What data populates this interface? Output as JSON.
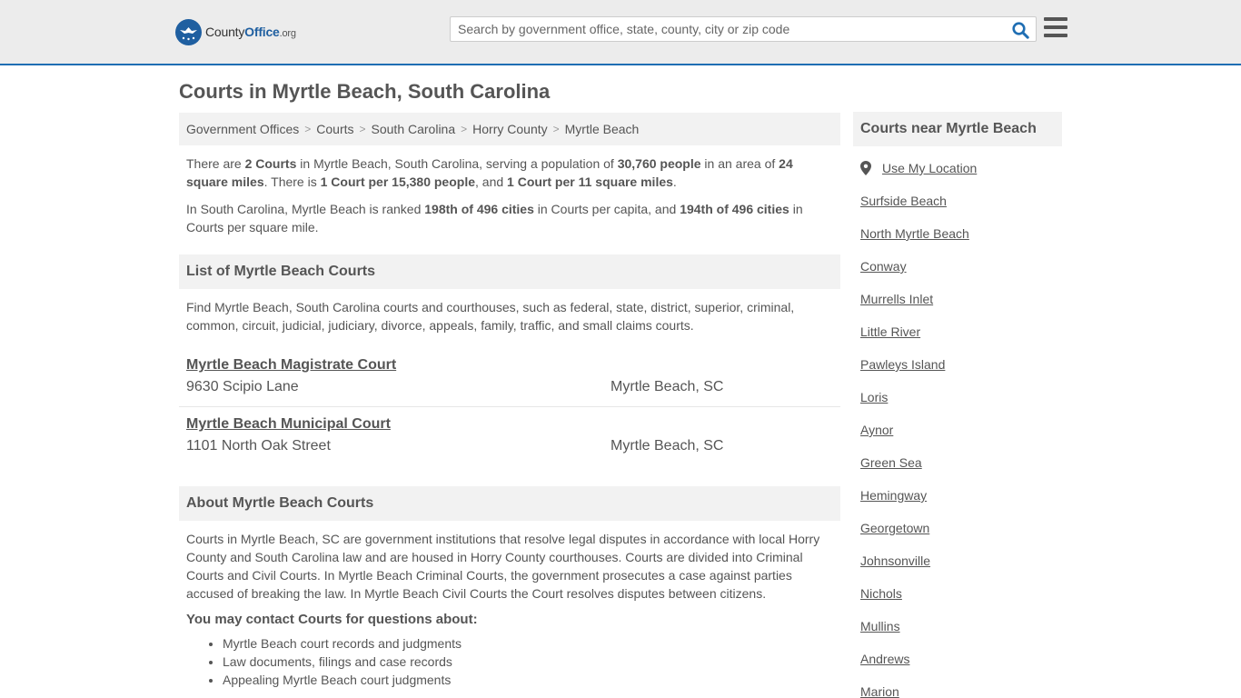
{
  "header": {
    "logo_main": "County",
    "logo_strong": "Office",
    "logo_org": ".org",
    "search_placeholder": "Search by government office, state, county, city or zip code"
  },
  "page_title": "Courts in Myrtle Beach, South Carolina",
  "breadcrumb": [
    "Government Offices",
    "Courts",
    "South Carolina",
    "Horry County",
    "Myrtle Beach"
  ],
  "intro": {
    "p1": {
      "t1": "There are ",
      "b1": "2 Courts",
      "t2": " in Myrtle Beach, South Carolina, serving a population of ",
      "b2": "30,760 people",
      "t3": " in an area of ",
      "b3": "24 square miles",
      "t4": ". There is ",
      "b4": "1 Court per 15,380 people",
      "t5": ", and ",
      "b5": "1 Court per 11 square miles",
      "t6": "."
    },
    "p2": {
      "t1": "In South Carolina, Myrtle Beach is ranked ",
      "b1": "198th of 496 cities",
      "t2": " in Courts per capita, and ",
      "b2": "194th of 496 cities",
      "t3": " in Courts per square mile."
    }
  },
  "list_section": {
    "title": "List of Myrtle Beach Courts",
    "description": "Find Myrtle Beach, South Carolina courts and courthouses, such as federal, state, district, superior, criminal, common, circuit, judicial, judiciary, divorce, appeals, family, traffic, and small claims courts.",
    "courts": [
      {
        "name": "Myrtle Beach Magistrate Court",
        "address": "9630 Scipio Lane",
        "city": "Myrtle Beach, SC"
      },
      {
        "name": "Myrtle Beach Municipal Court",
        "address": "1101 North Oak Street",
        "city": "Myrtle Beach, SC"
      }
    ]
  },
  "about_section": {
    "title": "About Myrtle Beach Courts",
    "description": "Courts in Myrtle Beach, SC are government institutions that resolve legal disputes in accordance with local Horry County and South Carolina law and are housed in Horry County courthouses. Courts are divided into Criminal Courts and Civil Courts. In Myrtle Beach Criminal Courts, the government prosecutes a case against parties accused of breaking the law. In Myrtle Beach Civil Courts the Court resolves disputes between citizens.",
    "contact_head": "You may contact Courts for questions about:",
    "contact_items": [
      "Myrtle Beach court records and judgments",
      "Law documents, filings and case records",
      "Appealing Myrtle Beach court judgments"
    ]
  },
  "sidebar": {
    "title": "Courts near Myrtle Beach",
    "use_location": "Use My Location",
    "cities": [
      "Surfside Beach",
      "North Myrtle Beach",
      "Conway",
      "Murrells Inlet",
      "Little River",
      "Pawleys Island",
      "Loris",
      "Aynor",
      "Green Sea",
      "Hemingway",
      "Georgetown",
      "Johnsonville",
      "Nichols",
      "Mullins",
      "Andrews",
      "Marion"
    ]
  },
  "colors": {
    "header_bg": "#ececec",
    "header_border": "#1f6eb3",
    "logo_blue": "#1f5fa0",
    "search_icon": "#1f6eb3"
  }
}
